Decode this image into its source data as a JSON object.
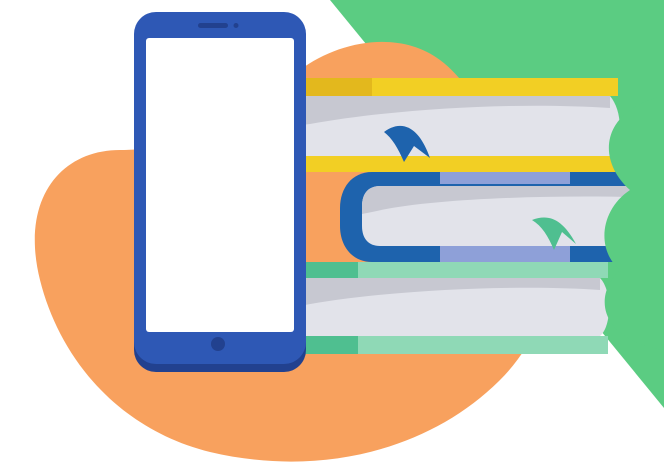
{
  "illustration": {
    "subject": "smartphone-beside-stacked-books",
    "colors": {
      "background": "#ffffff",
      "green_panel": "#5bcc82",
      "orange_blob": "#f8a15e",
      "phone_body": "#2e58b5",
      "phone_body_shadow": "#22418f",
      "phone_screen": "#ffffff",
      "book_top_cover": "#f2cf24",
      "book_top_spine_band": "#e3b81d",
      "book_middle_cover": "#1e63ad",
      "book_middle_band": "#8ea0d8",
      "book_bottom_cover": "#8fd9b6",
      "book_bottom_spine": "#4fbf90",
      "pages": "#e2e3ea",
      "page_shadow": "#c7c8d1",
      "bookmark_blue": "#1e63ad",
      "bookmark_green": "#4fbf90"
    },
    "icons": [
      "smartphone-icon",
      "book-icon",
      "bookmark-ribbon-icon"
    ]
  }
}
